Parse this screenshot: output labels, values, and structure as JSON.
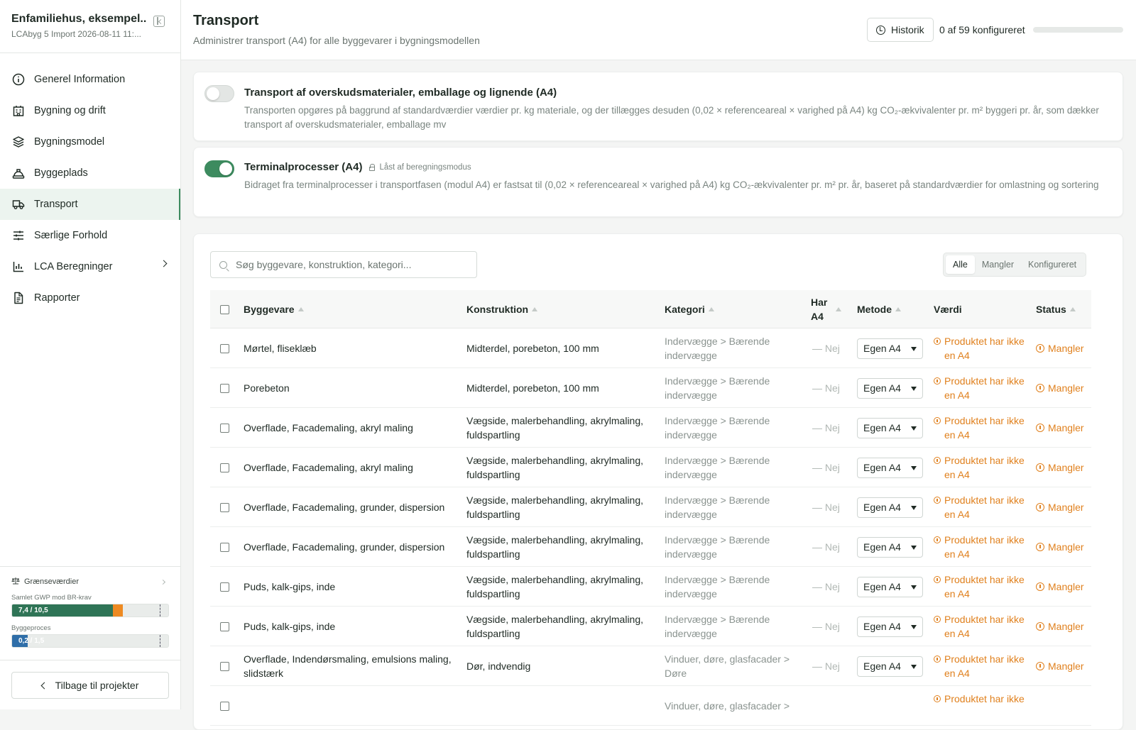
{
  "project": {
    "title": "Enfamiliehus, eksempel...",
    "subtitle": "LCAbyg 5 Import 2026-08-11 11:..."
  },
  "nav": [
    {
      "label": "Generel Information",
      "icon": "info-icon",
      "active": false
    },
    {
      "label": "Bygning og drift",
      "icon": "building-icon",
      "active": false
    },
    {
      "label": "Bygningsmodel",
      "icon": "layers-icon",
      "active": false
    },
    {
      "label": "Byggeplads",
      "icon": "helmet-icon",
      "active": false
    },
    {
      "label": "Transport",
      "icon": "truck-icon",
      "active": true
    },
    {
      "label": "Særlige Forhold",
      "icon": "sliders-icon",
      "active": false
    },
    {
      "label": "LCA Beregninger",
      "icon": "bar-chart-icon",
      "active": false,
      "has_submenu": true
    },
    {
      "label": "Rapporter",
      "icon": "document-icon",
      "active": false
    }
  ],
  "limits": {
    "title": "Grænseværdier",
    "gwp_label": "Samlet GWP mod BR-krav",
    "gwp_value": "7,4 / 10,5",
    "gwp_fraction": 0.7,
    "byggeproces_label": "Byggeproces",
    "byggeproces_value": "0,2 / 1,5",
    "byggeproces_fraction": 0.1
  },
  "back_label": "Tilbage til projekter",
  "header": {
    "title": "Transport",
    "subtitle": "Administrer transport (A4) for alle byggevarer i bygningsmodellen",
    "historik_label": "Historik",
    "config_count": "0 af 59 konfigureret",
    "progress_fraction": 0
  },
  "toggles": [
    {
      "title": "Transport af overskudsmaterialer, emballage og lignende (A4)",
      "lock_note": "",
      "on": false,
      "desc": "Transporten opgøres på baggrund af standardværdier værdier pr. kg materiale, og der tillægges desuden (0,02 × referenceareal × varighed på A4) kg CO₂-ækvivalenter pr. m² byggeri pr. år, som dækker transport af overskudsmaterialer, emballage mv"
    },
    {
      "title": "Terminalprocesser (A4)",
      "lock_note": "Låst af beregningsmodus",
      "on": true,
      "desc": "Bidraget fra terminalprocesser i transportfasen (modul A4) er fastsat til (0,02 × referenceareal × varighed på A4) kg CO₂-ækvivalenter pr. m² pr. år, baseret på standardværdier for omlastning og sortering"
    }
  ],
  "search": {
    "placeholder": "Søg byggevare, konstruktion, kategori..."
  },
  "filters": [
    "Alle",
    "Mangler",
    "Konfigureret"
  ],
  "columns": {
    "byggevare": "Byggevare",
    "konstruktion": "Konstruktion",
    "kategori": "Kategori",
    "har_a4": "Har A4",
    "metode": "Metode",
    "vaerdi": "Værdi",
    "status": "Status"
  },
  "rows": [
    {
      "byggevare": "Mørtel, fliseklæb",
      "konstruktion": "Midterdel, porebeton, 100 mm",
      "kategori": "Indervægge > Bærende indervægge",
      "har_a4": "— Nej",
      "metode": "Egen A4",
      "vaerdi": "Produktet har ikke en A4",
      "status": "Mangler"
    },
    {
      "byggevare": "Porebeton",
      "konstruktion": "Midterdel, porebeton, 100 mm",
      "kategori": "Indervægge > Bærende indervægge",
      "har_a4": "— Nej",
      "metode": "Egen A4",
      "vaerdi": "Produktet har ikke en A4",
      "status": "Mangler"
    },
    {
      "byggevare": "Overflade, Facademaling, akryl maling",
      "konstruktion": "Vægside, malerbehandling, akrylmaling, fuldspartling",
      "kategori": "Indervægge > Bærende indervægge",
      "har_a4": "— Nej",
      "metode": "Egen A4",
      "vaerdi": "Produktet har ikke en A4",
      "status": "Mangler"
    },
    {
      "byggevare": "Overflade, Facademaling, akryl maling",
      "konstruktion": "Vægside, malerbehandling, akrylmaling, fuldspartling",
      "kategori": "Indervægge > Bærende indervægge",
      "har_a4": "— Nej",
      "metode": "Egen A4",
      "vaerdi": "Produktet har ikke en A4",
      "status": "Mangler"
    },
    {
      "byggevare": "Overflade, Facademaling, grunder, dispersion",
      "konstruktion": "Vægside, malerbehandling, akrylmaling, fuldspartling",
      "kategori": "Indervægge > Bærende indervægge",
      "har_a4": "— Nej",
      "metode": "Egen A4",
      "vaerdi": "Produktet har ikke en A4",
      "status": "Mangler"
    },
    {
      "byggevare": "Overflade, Facademaling, grunder, dispersion",
      "konstruktion": "Vægside, malerbehandling, akrylmaling, fuldspartling",
      "kategori": "Indervægge > Bærende indervægge",
      "har_a4": "— Nej",
      "metode": "Egen A4",
      "vaerdi": "Produktet har ikke en A4",
      "status": "Mangler"
    },
    {
      "byggevare": "Puds, kalk-gips, inde",
      "konstruktion": "Vægside, malerbehandling, akrylmaling, fuldspartling",
      "kategori": "Indervægge > Bærende indervægge",
      "har_a4": "— Nej",
      "metode": "Egen A4",
      "vaerdi": "Produktet har ikke en A4",
      "status": "Mangler"
    },
    {
      "byggevare": "Puds, kalk-gips, inde",
      "konstruktion": "Vægside, malerbehandling, akrylmaling, fuldspartling",
      "kategori": "Indervægge > Bærende indervægge",
      "har_a4": "— Nej",
      "metode": "Egen A4",
      "vaerdi": "Produktet har ikke en A4",
      "status": "Mangler"
    },
    {
      "byggevare": "Overflade, Indendørsmaling, emulsions maling, slidstærk",
      "konstruktion": "Dør, indvendig",
      "kategori": "Vinduer, døre, glasfacader > Døre",
      "har_a4": "— Nej",
      "metode": "Egen A4",
      "vaerdi": "Produktet har ikke en A4",
      "status": "Mangler"
    },
    {
      "byggevare": "",
      "konstruktion": "",
      "kategori": "Vinduer, døre, glasfacader >",
      "har_a4": "",
      "metode": "",
      "vaerdi": "Produktet har ikke",
      "status": ""
    }
  ],
  "colors": {
    "accent": "#3d8b5f",
    "warning": "#e0801d",
    "over_limit": "#ee8a22",
    "process": "#2f6ea8"
  }
}
